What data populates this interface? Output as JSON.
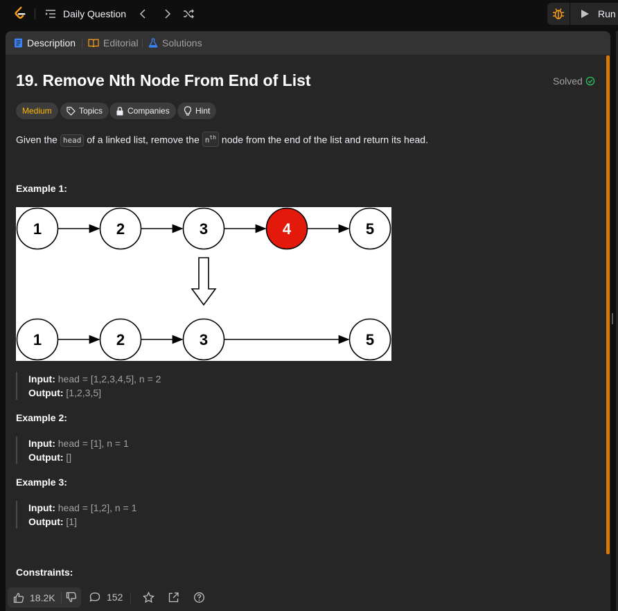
{
  "topbar": {
    "daily_question": "Daily Question",
    "run_label": "Run"
  },
  "tabs": [
    {
      "label": "Description",
      "icon": "description-icon",
      "active": true
    },
    {
      "label": "Editorial",
      "icon": "book-icon",
      "active": false
    },
    {
      "label": "Solutions",
      "icon": "flask-icon",
      "active": false
    }
  ],
  "problem": {
    "title": "19. Remove Nth Node From End of List",
    "status": "Solved",
    "difficulty": "Medium",
    "tags": [
      "Topics",
      "Companies",
      "Hint"
    ],
    "desc_before": "Given the ",
    "desc_code_head": "head",
    "desc_middle": " of a linked list, remove the ",
    "desc_code_n": "n",
    "desc_code_th": "th",
    "desc_after": " node from the end of the list and return its head."
  },
  "diagram": {
    "top_nodes": [
      "1",
      "2",
      "3",
      "4",
      "5"
    ],
    "bottom_nodes": [
      "1",
      "2",
      "3",
      "5"
    ],
    "removed_color": "#e31a0b"
  },
  "examples": [
    {
      "heading": "Example 1:",
      "input_label": "Input:",
      "input": "head = [1,2,3,4,5], n = 2",
      "output_label": "Output:",
      "output": "[1,2,3,5]"
    },
    {
      "heading": "Example 2:",
      "input_label": "Input:",
      "input": "head = [1], n = 1",
      "output_label": "Output:",
      "output": "[]"
    },
    {
      "heading": "Example 3:",
      "input_label": "Input:",
      "input": "head = [1,2], n = 1",
      "output_label": "Output:",
      "output": "[1]"
    }
  ],
  "constraints_heading": "Constraints:",
  "bottombar": {
    "likes": "18.2K",
    "comments": "152"
  },
  "colors": {
    "accent_medium": "#ffb800",
    "solved_check": "#2cbb5d",
    "active_tab_icon": "#3b82f6",
    "scroll_accent": "#d97706"
  }
}
